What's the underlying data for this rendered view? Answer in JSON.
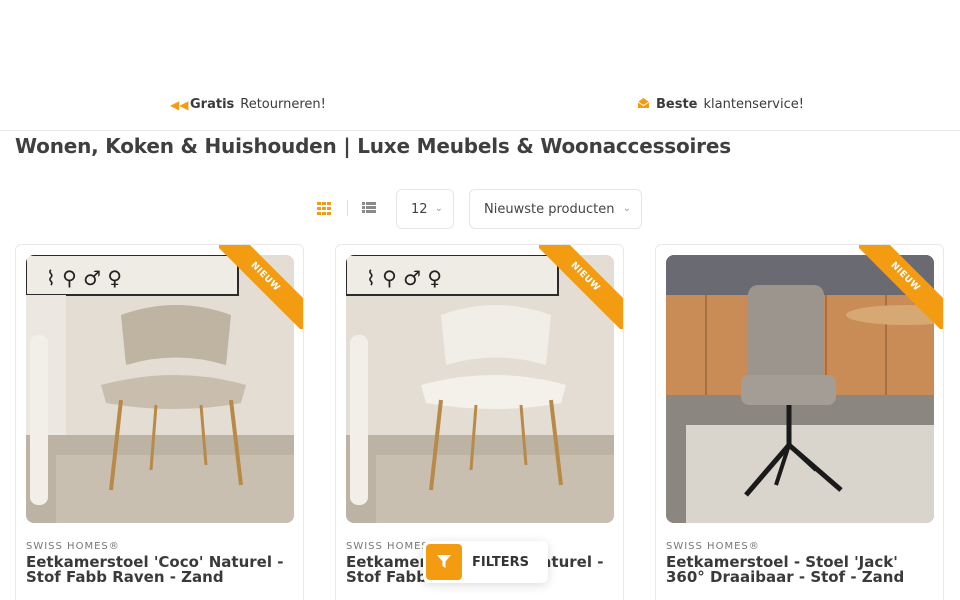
{
  "usp": [
    {
      "icon": "rewind-icon",
      "bold": "Gratis",
      "text": "Retourneren!"
    },
    {
      "icon": "envelope-icon",
      "bold": "Beste",
      "text": "klantenservice!"
    }
  ],
  "page_title": "Wonen, Koken & Huishouden | Luxe Meubels & Woonaccessoires",
  "toolbar": {
    "per_page": "12",
    "sort": "Nieuwste producten"
  },
  "colors": {
    "accent": "#f39c12"
  },
  "products": [
    {
      "badge": "NIEUW",
      "brand": "SWISS HOMES®",
      "name": "Eetkamerstoel 'Coco' Naturel - Stof Fabb Raven - Zand"
    },
    {
      "badge": "NIEUW",
      "brand": "SWISS HOMES®",
      "name": "Eetkamerstoel 'Coco' Naturel - Stof Fabb Raven - Zand"
    },
    {
      "badge": "NIEUW",
      "brand": "SWISS HOMES®",
      "name": "Eetkamerstoel - Stoel 'Jack' 360° Draaibaar - Stof - Zand"
    }
  ],
  "filters_label": "FILTERS"
}
